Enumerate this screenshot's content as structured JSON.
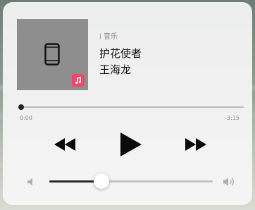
{
  "now_playing": {
    "source_label": "i 音乐",
    "title": "护花使者",
    "artist": "王海龙"
  },
  "progress": {
    "elapsed": "0:00",
    "remaining": "-3:15",
    "fraction": 0.0
  },
  "volume": {
    "level": 0.32
  },
  "icons": {
    "artwork": "phone-icon",
    "badge": "music-app-icon",
    "rewind": "rewind-icon",
    "play": "play-icon",
    "forward": "fast-forward-icon",
    "volume_low": "speaker-low-icon",
    "volume_high": "speaker-high-icon"
  },
  "colors": {
    "badge": "#f3456b",
    "progress_track": "#bdbdbd",
    "volume_fill": "#2a2a2a"
  }
}
